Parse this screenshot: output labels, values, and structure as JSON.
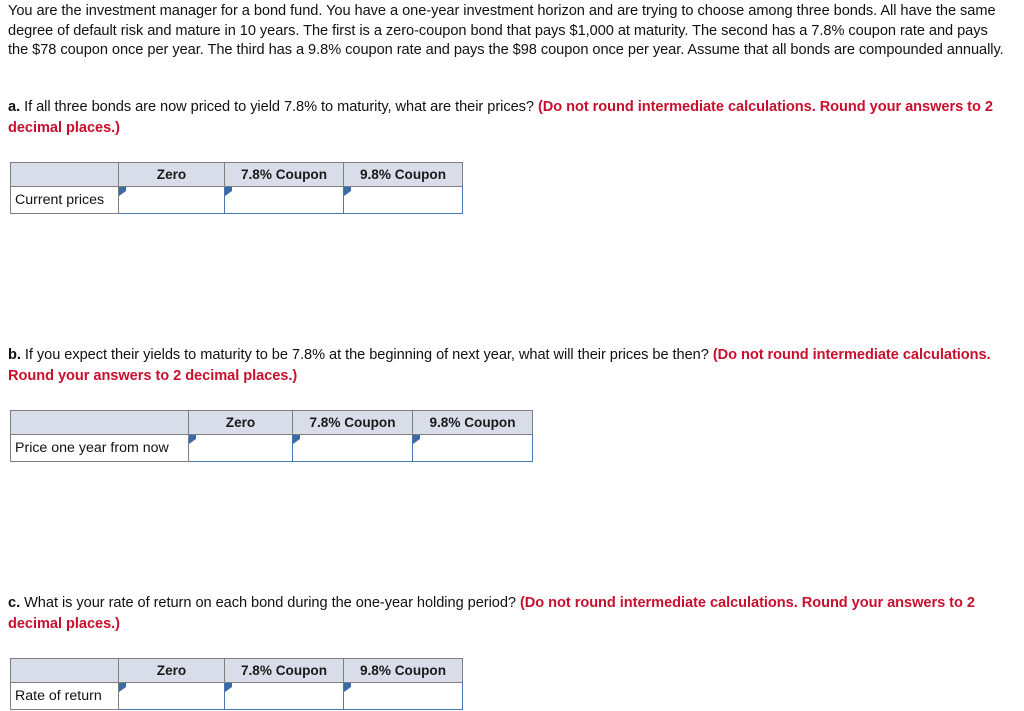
{
  "intro": {
    "paragraph": "You are the investment manager for a bond fund. You have a one-year investment horizon and are trying to choose among three bonds. All have the same degree of default risk and mature in 10 years. The first is a zero-coupon bond that pays $1,000 at maturity. The second has a 7.8% coupon rate and pays the $78 coupon once per year. The third has a 9.8% coupon rate and pays the $98 coupon once per year. Assume that all bonds are compounded annually."
  },
  "colors": {
    "note_red": "#c8102e",
    "header_fill": "#d9dde9",
    "input_border": "#4a76b8",
    "grid_border": "#7f7f7f",
    "marker_blue": "#3a6ba5"
  },
  "questions": [
    {
      "letter": "a.",
      "text": " If all three bonds are now priced to yield 7.8% to maturity, what are their prices? ",
      "note": "(Do not round intermediate calculations. Round your answers to 2 decimal places.)"
    },
    {
      "letter": "b.",
      "text": " If you expect their yields to maturity to be 7.8% at the beginning of next year, what will their prices be then? ",
      "note": "(Do not round intermediate calculations. Round your answers to 2 decimal places.)"
    },
    {
      "letter": "c.",
      "text": " What is your rate of return on each bond during the one-year holding period? ",
      "note": "(Do not round intermediate calculations. Round your answers to 2 decimal places.)"
    }
  ],
  "tables": [
    {
      "id": "table-a",
      "corner_header": "",
      "headers": [
        "Zero",
        "7.8% Coupon",
        "9.8% Coupon"
      ],
      "row_label": "Current prices",
      "values": [
        "",
        "",
        ""
      ]
    },
    {
      "id": "table-b",
      "corner_header": "",
      "headers": [
        "Zero",
        "7.8% Coupon",
        "9.8% Coupon"
      ],
      "row_label": "Price one year from now",
      "values": [
        "",
        "",
        ""
      ]
    },
    {
      "id": "table-c",
      "corner_header": "",
      "headers": [
        "Zero",
        "7.8% Coupon",
        "9.8% Coupon"
      ],
      "row_label": "Rate of return",
      "values": [
        "",
        "",
        ""
      ]
    }
  ]
}
